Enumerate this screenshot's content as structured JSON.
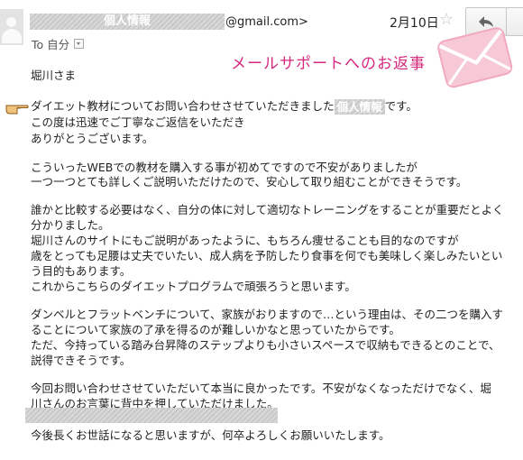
{
  "header": {
    "sender_redacted_label": "個人情報",
    "sender_domain": "@gmail.com>",
    "date": "2月10日",
    "star_icon": "star-outline-icon",
    "reply_icon": "reply-arrow-icon",
    "to_label": "To 自分"
  },
  "banner": {
    "title": "メールサポートへのお返事",
    "color": "#d6287e",
    "envelope_icon": "envelope-icon"
  },
  "email": {
    "greeting": "堀川さま",
    "p1_line1_before": "ダイエット教材についてお問い合わせさせていただきました",
    "p1_redacted": "個人情報",
    "p1_line1_after": "です。",
    "p1_line2": "この度は迅速でご丁寧なご返信をいただき",
    "p1_line3": "ありがとうございます。",
    "p2_line1": "こういったWEBでの教材を購入する事が初めてですので不安がありましたが",
    "p2_line2": "一つ一つとても詳しくご説明いただけたので、安心して取り組むことができそうです。",
    "p3_line1": "誰かと比較する必要はなく、自分の体に対して適切なトレーニングをすることが重要だとよく",
    "p3_line2": "分かりました。",
    "p3_line3": "堀川さんのサイトにもご説明があったように、もちろん痩せることも目的なのですが",
    "p3_line4": "歳をとっても足腰は丈夫でいたい、成人病を予防したり食事を何でも美味しく楽しみたいとい",
    "p3_line5": "う目的もあります。",
    "p3_line6": "これからこちらのダイエットプログラムで頑張ろうと思います。",
    "p4_line1": "ダンベルとフラットベンチについて、家族がおりますので…という理由は、その二つを購入す",
    "p4_line2": "ることについて家族の了承を得るのが難しいかなと思っていたからです。",
    "p4_line3": "ただ、今持っている踏み台昇降のステップよりも小さいスペースで収納もできるとのことで、",
    "p4_line4": "説得できそうです。",
    "p5_line1": "今回お問い合わせさせていただいて本当に良かったです。不安がなくなっただけでなく、堀",
    "p5_line2": "川さんのお言葉に背中を押していただけました。",
    "p6_line1": "今後長くお世話になると思いますが、何卒よろしくお願いいたします。"
  },
  "colors": {
    "redaction": "#cfcfcf",
    "text": "#222222"
  }
}
